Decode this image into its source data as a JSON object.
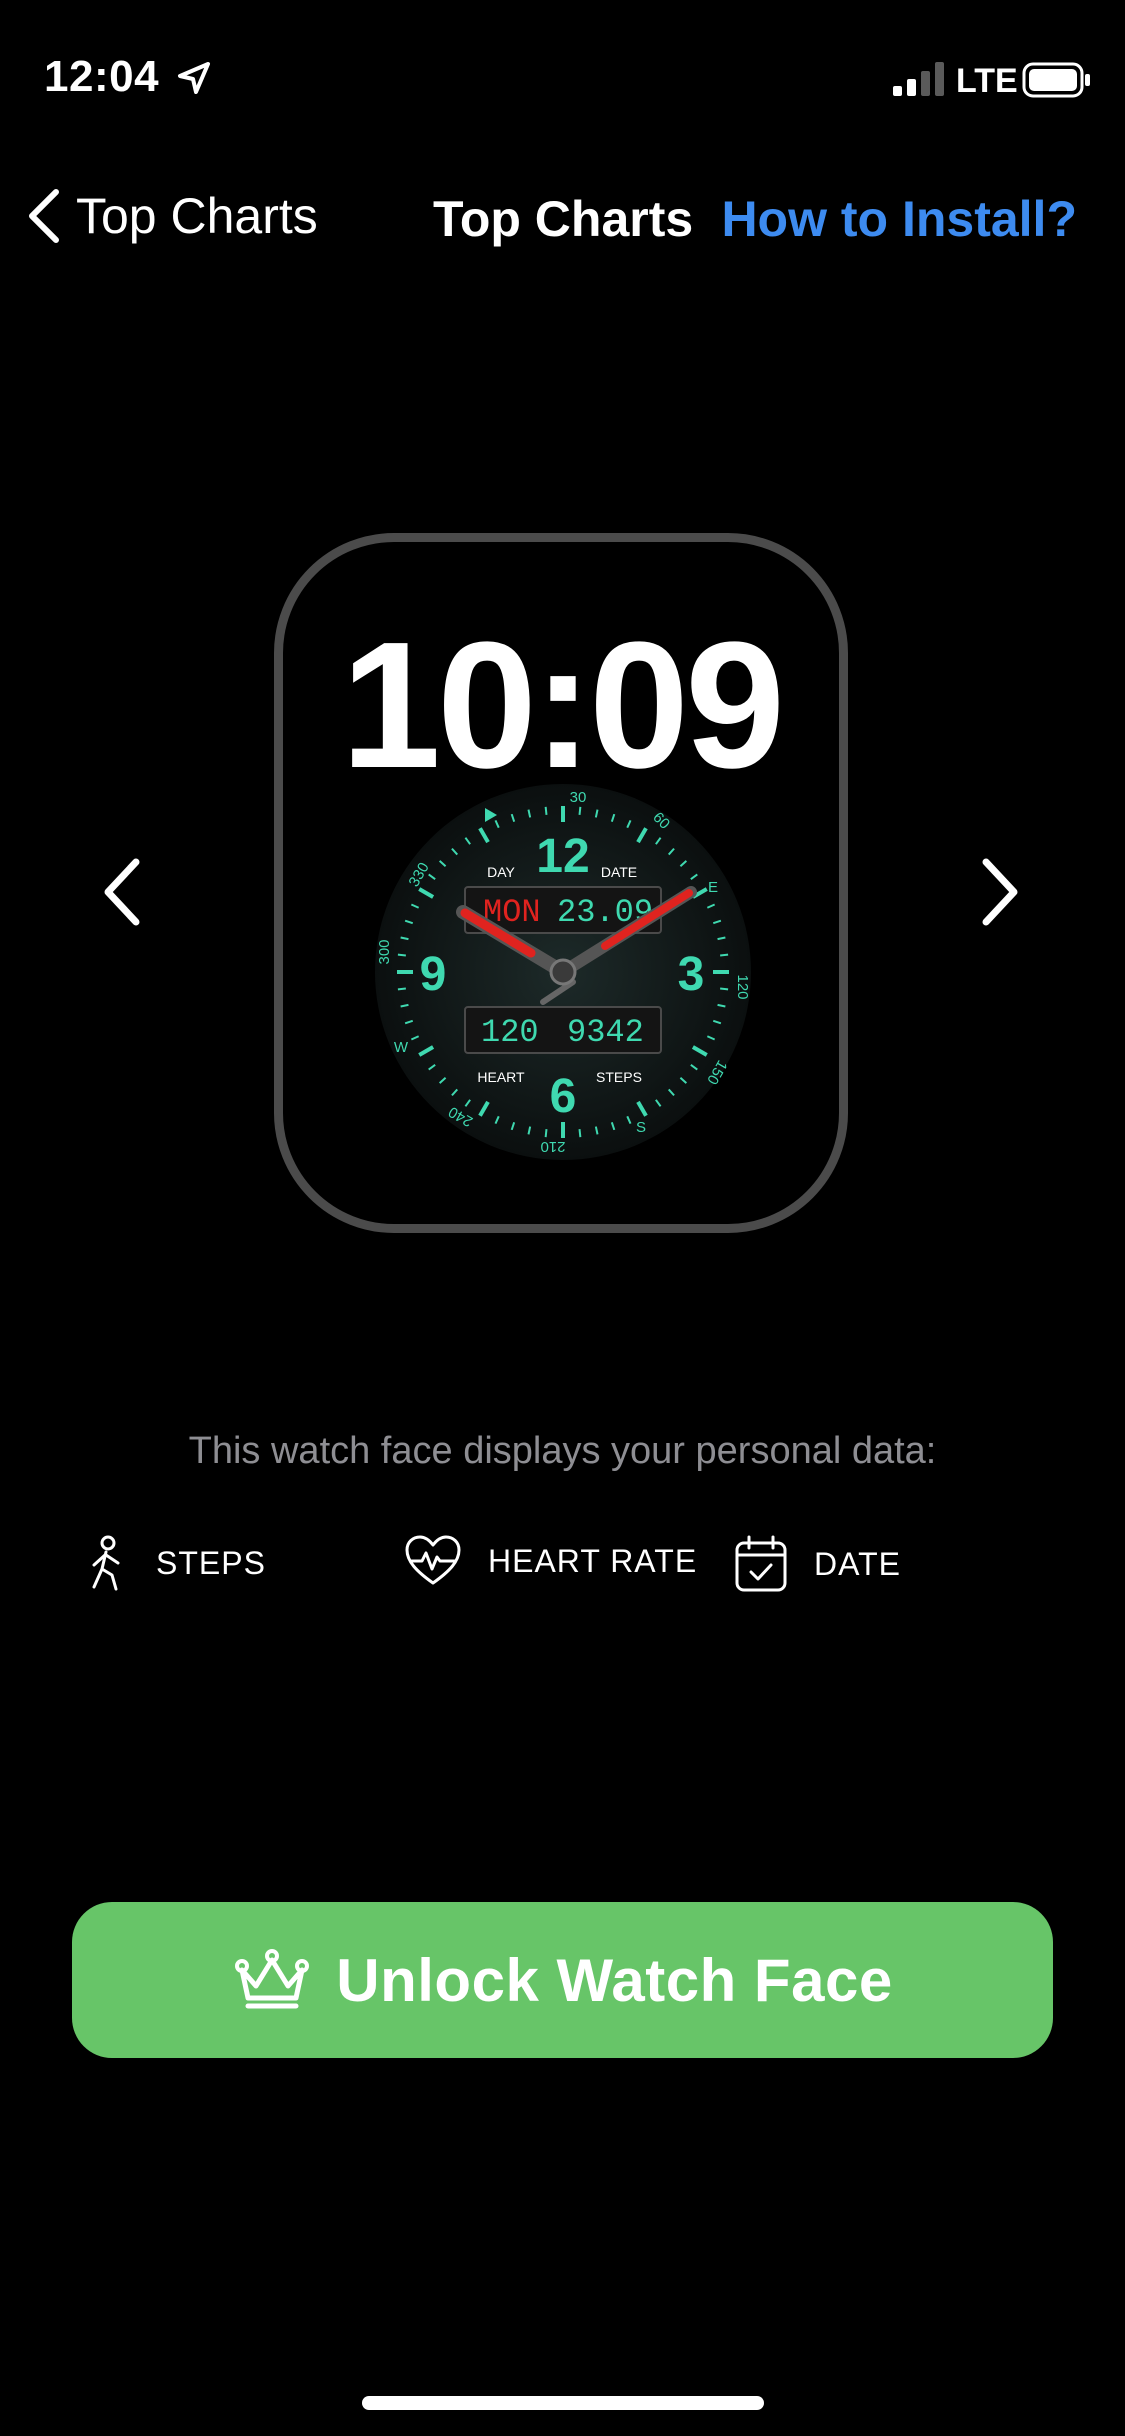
{
  "status_bar": {
    "time": "12:04",
    "network": "LTE"
  },
  "nav": {
    "back_label": "Top Charts",
    "title": "Top Charts",
    "install_link": "How to Install?"
  },
  "watch_preview": {
    "time": "10:09",
    "dial": {
      "day_label": "DAY",
      "date_label": "DATE",
      "day_value": "MON",
      "date_value": "23.09",
      "heart_label": "HEART",
      "steps_label": "STEPS",
      "heart_value": "120",
      "steps_value": "9342",
      "numerals": [
        "12",
        "3",
        "6",
        "9"
      ],
      "bezel_labels": [
        "30",
        "60",
        "E",
        "120",
        "150",
        "S",
        "210",
        "240",
        "W",
        "300",
        "330"
      ]
    }
  },
  "info_text": "This watch face displays your personal data:",
  "data_items": [
    {
      "icon": "walking-person-icon",
      "label": "STEPS"
    },
    {
      "icon": "heart-rate-icon",
      "label": "HEART RATE"
    },
    {
      "icon": "calendar-icon",
      "label": "DATE"
    }
  ],
  "unlock_button": {
    "icon": "crown-icon",
    "label": "Unlock Watch Face"
  },
  "colors": {
    "accent_blue": "#3d8bf0",
    "button_green": "#67c568",
    "dial_green": "#3fd9b0",
    "display_red": "#e0231f"
  }
}
